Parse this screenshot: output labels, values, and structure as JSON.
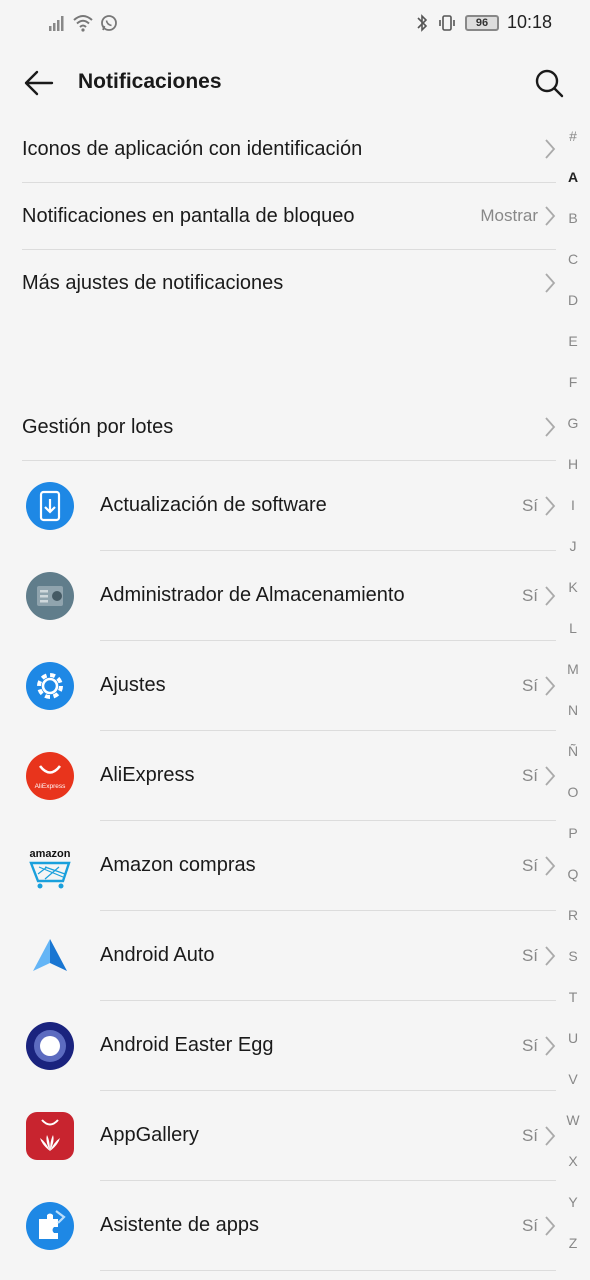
{
  "status_bar": {
    "time": "10:18",
    "battery": "96"
  },
  "header": {
    "title": "Notificaciones"
  },
  "settings": [
    {
      "label": "Iconos de aplicación con identificación",
      "value": ""
    },
    {
      "label": "Notificaciones en pantalla de bloqueo",
      "value": "Mostrar"
    },
    {
      "label": "Más ajustes de notificaciones",
      "value": ""
    },
    {
      "label": "Gestión por lotes",
      "value": ""
    }
  ],
  "apps": [
    {
      "name": "Actualización de software",
      "status": "Sí",
      "icon": "software-update-icon"
    },
    {
      "name": "Administrador de Almacenamiento",
      "status": "Sí",
      "icon": "storage-manager-icon"
    },
    {
      "name": "Ajustes",
      "status": "Sí",
      "icon": "settings-gear-icon"
    },
    {
      "name": "AliExpress",
      "status": "Sí",
      "icon": "aliexpress-icon",
      "icon_text": "AliExpress"
    },
    {
      "name": "Amazon compras",
      "status": "Sí",
      "icon": "amazon-icon",
      "icon_text": "amazon"
    },
    {
      "name": "Android Auto",
      "status": "Sí",
      "icon": "android-auto-icon"
    },
    {
      "name": "Android Easter Egg",
      "status": "Sí",
      "icon": "android-easter-egg-icon"
    },
    {
      "name": "AppGallery",
      "status": "Sí",
      "icon": "appgallery-icon"
    },
    {
      "name": "Asistente de apps",
      "status": "Sí",
      "icon": "app-assistant-icon"
    }
  ],
  "alphabet_index": [
    "#",
    "A",
    "B",
    "C",
    "D",
    "E",
    "F",
    "G",
    "H",
    "I",
    "J",
    "K",
    "L",
    "M",
    "N",
    "Ñ",
    "O",
    "P",
    "Q",
    "R",
    "S",
    "T",
    "U",
    "V",
    "W",
    "X",
    "Y",
    "Z"
  ],
  "colors": {
    "accent": "#1a1a1a",
    "active_letter": "#222222",
    "muted": "#888888",
    "background": "#f5f5f5"
  }
}
